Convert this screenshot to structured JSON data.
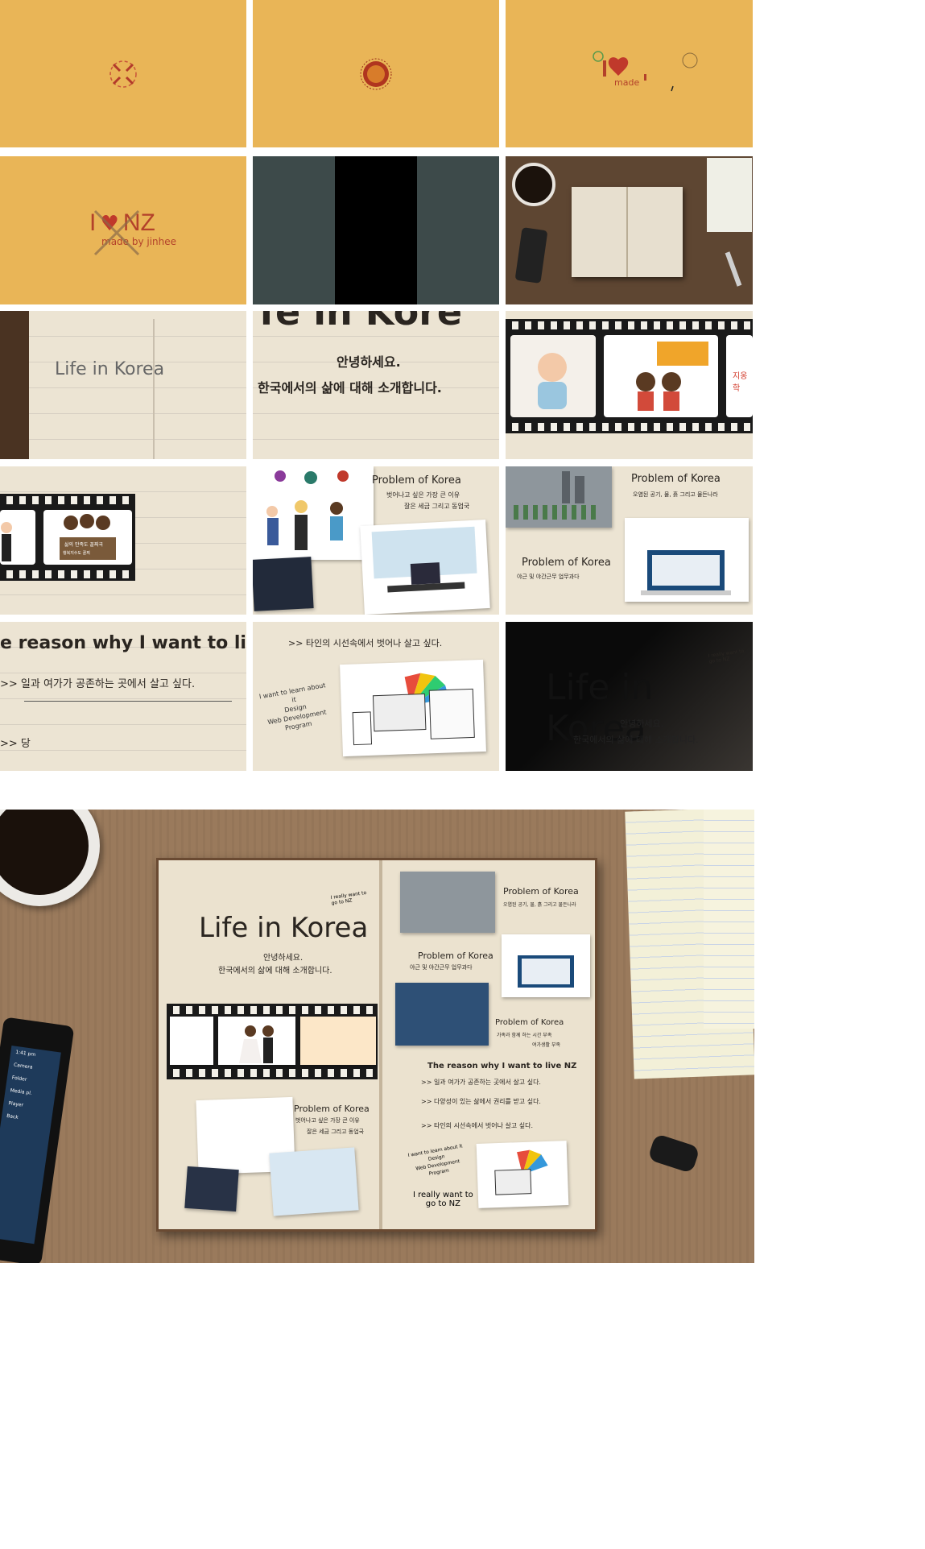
{
  "logo": {
    "prefix": "I",
    "suffix": "NZ",
    "made_small": "made",
    "made_full": "made by jinhee"
  },
  "notebook_title": "Life in Korea",
  "greeting": "안녕하세요.",
  "intro": "한국에서의 삶에 대해 소개합니다.",
  "frame7_title": "Life in Korea",
  "frame8": {
    "title_fragment": "fe in Kore"
  },
  "frame9": {
    "side_label": "지옹학"
  },
  "banner": {
    "line1": "삶의 만족도 꼴찌국",
    "line2": "행복지수도 꼴찌"
  },
  "problems": [
    {
      "title": "Problem of Korea",
      "desc1": "벗어나고 싶은 가장 큰 이유",
      "desc2": "잘은 세금 그리고 동업국"
    },
    {
      "title": "Problem of Korea",
      "desc1": "오염된 공기, 물, 흙 그리고 물든나라",
      "desc2": ""
    },
    {
      "title": "Problem of Korea",
      "desc1": "야근 및 야간근무 업무과다",
      "desc2": ""
    },
    {
      "title": "Problem of Korea",
      "desc1": "가족과 함께 하는 시간 부족",
      "desc2": "여가생활 부족"
    }
  ],
  "reason": {
    "title": "The reason why I want to live NZ",
    "title_fragment": "e reason why I want to live",
    "items": [
      ">> 일과 여가가 공존하는 곳에서 살고 싶다.",
      ">> 다양성이 있는 삶에서 권리를 받고 싶다.",
      ">> 타인의 시선속에서 벗어나 살고 싶다."
    ],
    "short": ">> 당"
  },
  "learn_note": [
    "I want to learn about it",
    "Design",
    "Web Development",
    "Program"
  ],
  "corner_note": [
    "I really want to",
    "go to NZ"
  ],
  "closing_note": [
    "I really want to",
    "go to NZ"
  ],
  "phone_labels": [
    "1:41 pm",
    "Camera",
    "Folder",
    "Media pl.",
    "Player",
    "Back"
  ],
  "colors": {
    "gold": "#e9b557",
    "paper": "#ece4d3",
    "wood": "#8a6a4a",
    "heart": "#c0392b"
  }
}
